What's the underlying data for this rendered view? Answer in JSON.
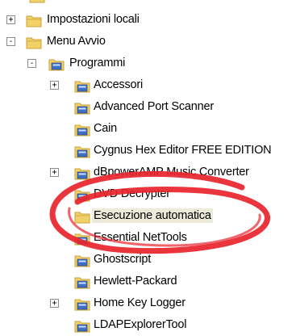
{
  "tree": {
    "items": [
      {
        "label": "Impostazioni locali",
        "level": 0,
        "expander": "+",
        "icon": "folder-icon"
      },
      {
        "label": "Menu Avvio",
        "level": 0,
        "expander": "-",
        "icon": "folder-icon"
      },
      {
        "label": "Programmi",
        "level": 1,
        "expander": "-",
        "icon": "program-folder-icon"
      },
      {
        "label": "Accessori",
        "level": 2,
        "expander": "+",
        "icon": "program-folder-icon"
      },
      {
        "label": "Advanced Port Scanner",
        "level": 2,
        "expander": "",
        "icon": "program-folder-icon"
      },
      {
        "label": "Cain",
        "level": 2,
        "expander": "",
        "icon": "program-folder-icon"
      },
      {
        "label": "Cygnus Hex Editor FREE EDITION",
        "level": 2,
        "expander": "",
        "icon": "program-folder-icon"
      },
      {
        "label": "dBpowerAMP Music Converter",
        "level": 2,
        "expander": "+",
        "icon": "program-folder-icon"
      },
      {
        "label": "DVD Decrypter",
        "level": 2,
        "expander": "",
        "icon": "program-folder-icon"
      },
      {
        "label": "Esecuzione automatica",
        "level": 2,
        "expander": "",
        "icon": "folder-icon",
        "selected": true
      },
      {
        "label": "Essential NetTools",
        "level": 2,
        "expander": "",
        "icon": "program-folder-icon"
      },
      {
        "label": "Ghostscript",
        "level": 2,
        "expander": "",
        "icon": "program-folder-icon"
      },
      {
        "label": "Hewlett-Packard",
        "level": 2,
        "expander": "",
        "icon": "program-folder-icon"
      },
      {
        "label": "Home Key Logger",
        "level": 2,
        "expander": "+",
        "icon": "program-folder-icon"
      },
      {
        "label": "LDAPExplorerTool",
        "level": 2,
        "expander": "",
        "icon": "program-folder-icon"
      }
    ]
  },
  "colors": {
    "folder_yellow": "#f2d268",
    "folder_yellow_dark": "#c9a23a",
    "program_blue": "#3f6fc0",
    "selection": "#ecead8",
    "annotation_red": "#e8242c"
  }
}
